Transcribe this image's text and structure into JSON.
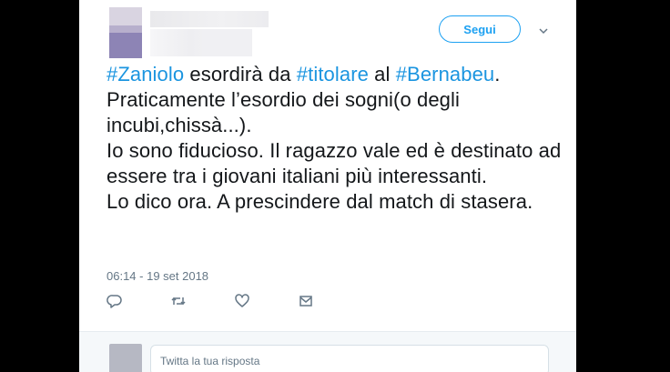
{
  "tweet": {
    "follow_label": "Segui",
    "text_parts": {
      "p1": "#Zaniolo",
      "p2": " esordirà da ",
      "p3": "#titolare",
      "p4": " al ",
      "p5": "#Bernabeu",
      "p6": ".",
      "line2": "Praticamente l’esordio dei sogni(o degli incubi,chissà...).",
      "line3": "Io sono fiducioso. Il ragazzo vale ed è destinato ad essere tra i giovani italiani più interessanti.",
      "line4": "Lo dico ora. A prescindere dal match di stasera."
    },
    "timestamp": "06:14 - 19 set 2018"
  },
  "actions": {
    "reply_icon": "reply-icon",
    "retweet_icon": "retweet-icon",
    "like_icon": "heart-icon",
    "message_icon": "envelope-icon"
  },
  "reply": {
    "placeholder": "Twitta la tua risposta"
  },
  "colors": {
    "accent": "#1da1f2",
    "hashtag": "#1b95e0",
    "text": "#14171a",
    "muted": "#657786",
    "background": "#000000"
  }
}
